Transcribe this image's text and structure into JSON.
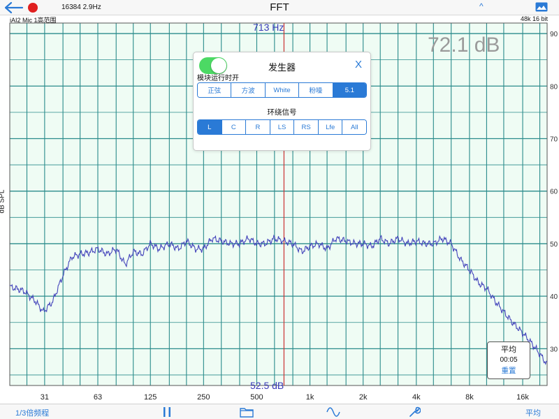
{
  "header": {
    "title": "FFT",
    "fft_size": "16384  2.9Hz",
    "input": "iAI2 Mic 1高范围",
    "format": "48k 16 bit",
    "icons": {
      "back": "back-arrow-icon",
      "record": "record-dot-icon",
      "up": "caret-up-icon",
      "image": "image-icon"
    }
  },
  "readouts": {
    "cursor_freq": "713 Hz",
    "cursor_level": "52.5 dB",
    "overall_level": "72.1 dB",
    "y_axis_label": "dB SPL"
  },
  "generator": {
    "title": "发生器",
    "close": "X",
    "toggle_label": "模块运行时开",
    "toggle_on": true,
    "signal_options": [
      "正弦",
      "方波",
      "White",
      "粉噪",
      "5.1"
    ],
    "signal_selected": 4,
    "surround_label": "环绕信号",
    "channel_options": [
      "L",
      "C",
      "R",
      "LS",
      "RS",
      "Lfe",
      "All"
    ],
    "channel_selected": 0
  },
  "average": {
    "title": "平均",
    "time": "00:05",
    "reset": "重置"
  },
  "toolbar": {
    "octave": "1/3倍频程",
    "average": "平均",
    "icons": [
      "pause-icon",
      "folder-icon",
      "waveform-icon",
      "wrench-icon"
    ]
  },
  "colors": {
    "accent": "#2a7ad6",
    "grid_bg": "#effcf4",
    "grid_line": "#2a8b8b",
    "trace": "#4444bb",
    "cursor": "#cc3333"
  },
  "chart_data": {
    "type": "line",
    "xscale": "log",
    "x_ticks": [
      "31",
      "63",
      "125",
      "250",
      "500",
      "1k",
      "2k",
      "4k",
      "8k",
      "16k"
    ],
    "y_ticks": [
      30,
      40,
      50,
      60,
      70,
      80,
      90
    ],
    "ylim": [
      23,
      92
    ],
    "xlim": [
      20,
      22000
    ],
    "ylabel": "dB SPL",
    "cursor_hz": 713,
    "series": [
      {
        "x": [
          20,
          24,
          28,
          31,
          35,
          40,
          45,
          50,
          56,
          63,
          71,
          80,
          90,
          100,
          112,
          125,
          140,
          160,
          180,
          200,
          225,
          250,
          280,
          315,
          355,
          400,
          450,
          500,
          560,
          630,
          710,
          800,
          900,
          1000,
          1120,
          1250,
          1400,
          1600,
          1800,
          2000,
          2240,
          2500,
          2800,
          3150,
          3550,
          4000,
          4500,
          5000,
          5600,
          6300,
          7100,
          8000,
          9000,
          10000,
          11200,
          12500,
          14000,
          16000,
          18000,
          20000,
          22000
        ],
        "y": [
          41.8,
          41.0,
          39.0,
          37.0,
          39.0,
          44.0,
          47.5,
          48.0,
          48.3,
          49.0,
          48.0,
          49.0,
          46.0,
          48.5,
          48.0,
          50.0,
          49.0,
          50.0,
          49.0,
          50.5,
          49.0,
          49.0,
          51.0,
          50.5,
          50.0,
          50.0,
          51.0,
          50.0,
          50.0,
          51.0,
          50.5,
          50.0,
          48.5,
          49.5,
          50.0,
          49.0,
          51.0,
          50.5,
          50.0,
          50.0,
          49.5,
          51.0,
          50.0,
          51.0,
          50.0,
          50.5,
          50.0,
          50.0,
          51.0,
          50.0,
          47.0,
          45.0,
          42.5,
          41.5,
          39.0,
          37.0,
          35.0,
          33.0,
          31.0,
          29.0,
          27.0
        ]
      }
    ]
  }
}
